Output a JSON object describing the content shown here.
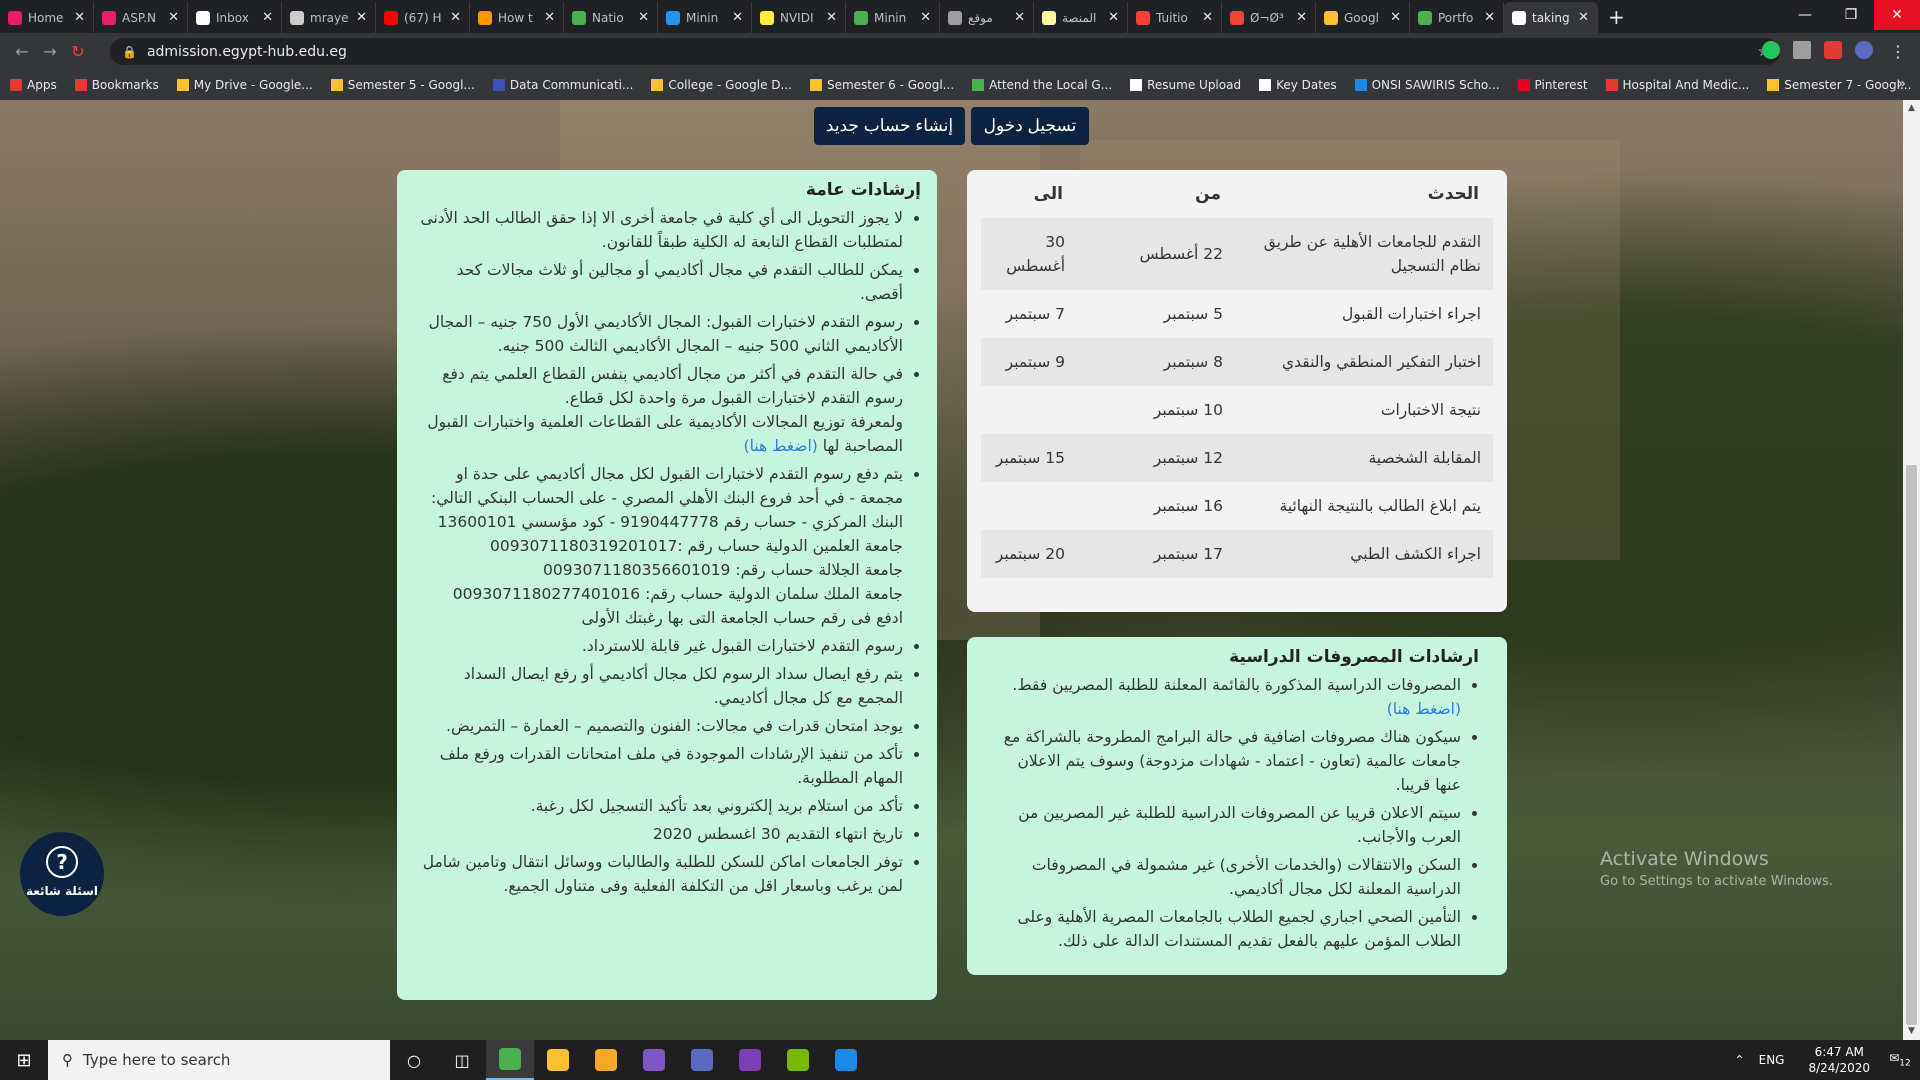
{
  "browser": {
    "tabs": [
      {
        "title": "Home",
        "color": "#e91e63"
      },
      {
        "title": "ASP.N",
        "color": "#e91e63"
      },
      {
        "title": "Inbox",
        "color": "#ffffff"
      },
      {
        "title": "mraye",
        "color": "#cccccc"
      },
      {
        "title": "(67) H",
        "color": "#ff0000"
      },
      {
        "title": "How t",
        "color": "#ff9800"
      },
      {
        "title": "Natio",
        "color": "#4caf50"
      },
      {
        "title": "Minin",
        "color": "#2196f3"
      },
      {
        "title": "NVIDI",
        "color": "#ffeb3b"
      },
      {
        "title": "Minin",
        "color": "#4caf50"
      },
      {
        "title": "موقع",
        "color": "#9e9e9e"
      },
      {
        "title": "المنصة",
        "color": "#fff59d"
      },
      {
        "title": "Tuitio",
        "color": "#f44336"
      },
      {
        "title": "Ø¬Ø³",
        "color": "#f44336"
      },
      {
        "title": "Googl",
        "color": "#fbc02d"
      },
      {
        "title": "Portfo",
        "color": "#4caf50"
      },
      {
        "title": "taking",
        "color": "#ffffff"
      }
    ],
    "active_tab_index": 16,
    "new_tab_label": "+",
    "url": "admission.egypt-hub.edu.eg",
    "bookmarks": [
      {
        "label": "Apps",
        "color": "#e53935"
      },
      {
        "label": "Bookmarks",
        "color": "#e53935"
      },
      {
        "label": "My Drive - Google...",
        "color": "#fbc02d"
      },
      {
        "label": "Semester 5 - Googl...",
        "color": "#fbc02d"
      },
      {
        "label": "Data Communicati...",
        "color": "#3f51b5"
      },
      {
        "label": "College - Google D...",
        "color": "#fbc02d"
      },
      {
        "label": "Semester 6 - Googl...",
        "color": "#fbc02d"
      },
      {
        "label": "Attend the Local G...",
        "color": "#4caf50"
      },
      {
        "label": "Resume Upload",
        "color": "#ffffff"
      },
      {
        "label": "Key Dates",
        "color": "#ffffff"
      },
      {
        "label": "ONSI SAWIRIS Scho...",
        "color": "#1e88e5"
      },
      {
        "label": "Pinterest",
        "color": "#e60023"
      },
      {
        "label": "Hospital And Medic...",
        "color": "#e53935"
      },
      {
        "label": "Semester 7 - Googl...",
        "color": "#fbc02d"
      }
    ],
    "more_label": "»"
  },
  "header_buttons": {
    "login": "تسجيل دخول",
    "register": "إنشاء حساب جديد"
  },
  "events_table": {
    "headers": {
      "event": "الحدث",
      "from": "من",
      "to": "الى"
    },
    "rows": [
      {
        "event": "التقدم للجامعات الأهلية عن طريق نظام التسجيل",
        "from": "22 أغسطس",
        "to": "30 أغسطس"
      },
      {
        "event": "اجراء اختبارات القبول",
        "from": "5 سبتمبر",
        "to": "7 سبتمبر"
      },
      {
        "event": "اختبار التفكير المنطقي والنقدي",
        "from": "8 سبتمبر",
        "to": "9 سبتمبر"
      },
      {
        "event": "نتيجة الاختبارات",
        "from": "10 سبتمبر",
        "to": ""
      },
      {
        "event": "المقابلة الشخصية",
        "from": "12 سبتمبر",
        "to": "15 سبتمبر"
      },
      {
        "event": "يتم ابلاغ الطالب بالنتيجة النهائية",
        "from": "16 سبتمبر",
        "to": ""
      },
      {
        "event": "اجراء الكشف الطبي",
        "from": "17 سبتمبر",
        "to": "20 سبتمبر"
      }
    ]
  },
  "general_guidelines": {
    "title": "إرشادات عامة",
    "items": [
      "لا يجوز التحويل الى أي كلية في جامعة أخرى الا إذا حقق الطالب الحد الأدنى لمتطلبات القطاع التابعة له الكلية طبقاً للقانون.",
      "يمكن للطالب التقدم في مجال أكاديمي أو مجالين أو ثلاث مجالات كحد أقصى.",
      "رسوم التقدم لاختبارات القبول: المجال الأكاديمي الأول 750 جنيه – المجال الأكاديمي الثاني 500 جنيه – المجال الأكاديمي الثالث 500 جنيه.",
      "في حالة التقدم في أكثر من مجال أكاديمي بنفس القطاع العلمي يتم دفع رسوم التقدم لاختبارات القبول مرة واحدة لكل قطاع.",
      "يتم دفع رسوم التقدم لاختبارات القبول لكل مجال أكاديمي على حدة او مجمعة - في أحد فروع البنك الأهلي المصري - على الحساب البنكي التالي: البنك المركزي - حساب رقم 9190447778 - كود مؤسسي 13600101",
      "رسوم التقدم لاختبارات القبول غير قابلة للاسترداد.",
      "يتم رفع ايصال سداد الرسوم لكل مجال أكاديمي أو رفع ايصال السداد المجمع مع كل مجال أكاديمي.",
      "يوجد امتحان قدرات في مجالات: الفنون والتصميم – العمارة – التمريض.",
      "تأكد من تنفيذ الإرشادات الموجودة في ملف امتحانات القدرات ورفع ملف المهام المطلوبة.",
      "تأكد من استلام بريد إلكتروني بعد تأكيد التسجيل لكل رغبة.",
      "تاريخ انتهاء التقديم 30 اغسطس 2020",
      "توفر الجامعات اماكن للسكن للطلبة والطالبات ووسائل انتقال وتامين شامل لمن يرغب وباسعار اقل من التكلفة الفعلية وفى متناول الجميع."
    ],
    "sector_note": "ولمعرفة توزيع المجالات الأكاديمية على القطاعات العلمية واختبارات القبول المصاحبة لها",
    "click_here": "(اضغط هنا)",
    "bank_lines": [
      "جامعة العلمين الدولية حساب رقم :0093071180319201017",
      "جامعة الجلالة حساب رقم: 0093071180356601019",
      "جامعة الملك سلمان الدولية حساب رقم: 0093071180277401016",
      "ادفع فى رقم حساب الجامعة التى بها رغبتك الأولى"
    ]
  },
  "fees_guidelines": {
    "title": "ارشادات المصروفات الدراسية",
    "items": [
      "المصروفات الدراسية المذكورة بالقائمة المعلنة للطلبة المصريين فقط.",
      "سيكون هناك مصروفات اضافية في حالة البرامج المطروحة بالشراكة مع جامعات عالمية (تعاون - اعتماد - شهادات مزدوجة) وسوف يتم الاعلان عنها قريبا.",
      "سيتم الاعلان قريبا عن المصروفات الدراسية للطلبة غير المصريين من العرب والأجانب.",
      "السكن والانتقالات (والخدمات الأخرى) غير مشمولة في المصروفات الدراسية المعلنة لكل مجال أكاديمي.",
      "التأمين الصحي اجباري لجميع الطلاب بالجامعات المصرية الأهلية وعلى الطلاب المؤمن عليهم بالفعل تقديم المستندات الدالة على ذلك."
    ],
    "click_here": "(اضغط هنا)"
  },
  "faq": {
    "label": "اسئلة شائعة",
    "icon": "question-mark-icon"
  },
  "watermark": {
    "line1": "Activate Windows",
    "line2": "Go to Settings to activate Windows."
  },
  "taskbar": {
    "search_placeholder": "Type here to search",
    "lang": "ENG",
    "time": "6:47 AM",
    "date": "8/24/2020",
    "notification_count": "12",
    "apps": [
      {
        "name": "chrome",
        "color": "#4caf50"
      },
      {
        "name": "chrome-2",
        "color": "#fbc02d"
      },
      {
        "name": "file-explorer",
        "color": "#f9a825"
      },
      {
        "name": "app-purple",
        "color": "#7e57c2"
      },
      {
        "name": "app-discord",
        "color": "#5c6bc0"
      },
      {
        "name": "visual-studio",
        "color": "#7b3fb5"
      },
      {
        "name": "nvidia",
        "color": "#76b900"
      },
      {
        "name": "photos",
        "color": "#1e88e5"
      }
    ]
  }
}
